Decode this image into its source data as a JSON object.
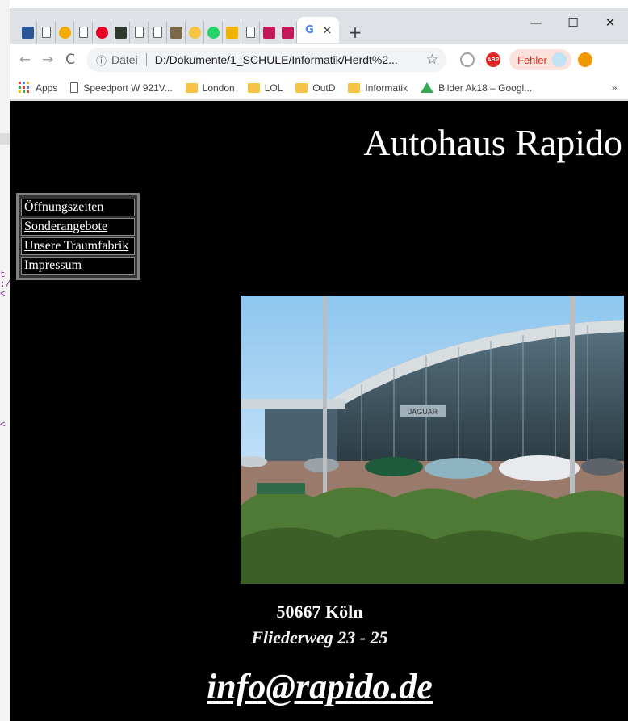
{
  "browser": {
    "tab_title_short": "G",
    "tab_close": "×",
    "new_tab": "+",
    "window_controls": {
      "minimize": "—",
      "maximize": "☐",
      "close": "✕"
    },
    "nav": {
      "back": "←",
      "forward": "→",
      "reload": "C"
    },
    "address_bar": {
      "scheme_label": "Datei",
      "url": "D:/Dokumente/1_SCHULE/Informatik/Herdt%2..."
    },
    "error_pill": "Fehler",
    "extension_abp": "ABP"
  },
  "bookmarks": {
    "items": [
      {
        "label": "Apps",
        "icon": "apps-grid-icon"
      },
      {
        "label": "Speedport W 921V...",
        "icon": "page-icon"
      },
      {
        "label": "London",
        "icon": "folder-icon"
      },
      {
        "label": "LOL",
        "icon": "folder-icon"
      },
      {
        "label": "OutD",
        "icon": "folder-icon"
      },
      {
        "label": "Informatik",
        "icon": "folder-icon"
      },
      {
        "label": "Bilder Ak18 – Googl...",
        "icon": "google-drive-icon"
      }
    ],
    "more": "»"
  },
  "page": {
    "title": "Autohaus Rapido",
    "menu": [
      "Öffnungszeiten",
      "Sonderangebote",
      "Unsere Traumfabrik",
      "Impressum"
    ],
    "showroom_sign": "JAGUAR",
    "address_city": "50667 Köln",
    "address_street": "Fliederweg 23 - 25",
    "email": "info@rapido.de"
  },
  "colors": {
    "page_background": "#000000",
    "page_text": "#ffffff",
    "tabstrip": "#dee1e6",
    "error_text": "#d93025",
    "error_bg": "#fbe1dc"
  }
}
